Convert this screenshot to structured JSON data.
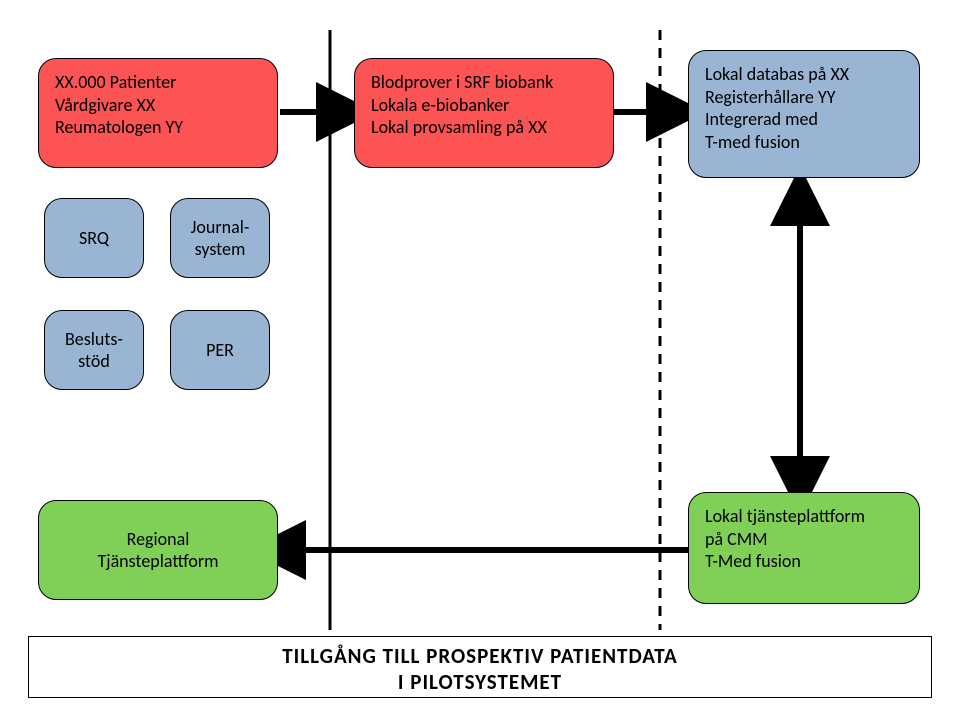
{
  "boxes": {
    "patients": {
      "line1": "XX.000 Patienter",
      "line2": "Vårdgivare XX",
      "line3": "Reumatologen YY"
    },
    "biobank": {
      "line1": "Blodprover i SRF biobank",
      "line2": "Lokala e-biobanker",
      "line3": "Lokal provsamling på XX"
    },
    "db": {
      "line1": "Lokal databas på XX",
      "line2": "Registerhållare YY",
      "line3": "Integrerad med",
      "line4": "T-med fusion"
    },
    "srq": "SRQ",
    "journal": "Journal-\nsystem",
    "besluts": "Besluts-\nstöd",
    "per": "PER",
    "regional": {
      "line1": "Regional",
      "line2": "Tjänsteplattform"
    },
    "local_platform": {
      "line1": "Lokal tjänsteplattform",
      "line2": "på CMM",
      "line3": "T-Med fusion"
    },
    "footer": {
      "line1": "TILLGÅNG TILL PROSPEKTIV PATIENTDATA",
      "line2": "I PILOTSYSTEMET"
    }
  },
  "colors": {
    "red": "#fc5454",
    "blue": "#9ab5d3",
    "green": "#80d058"
  }
}
